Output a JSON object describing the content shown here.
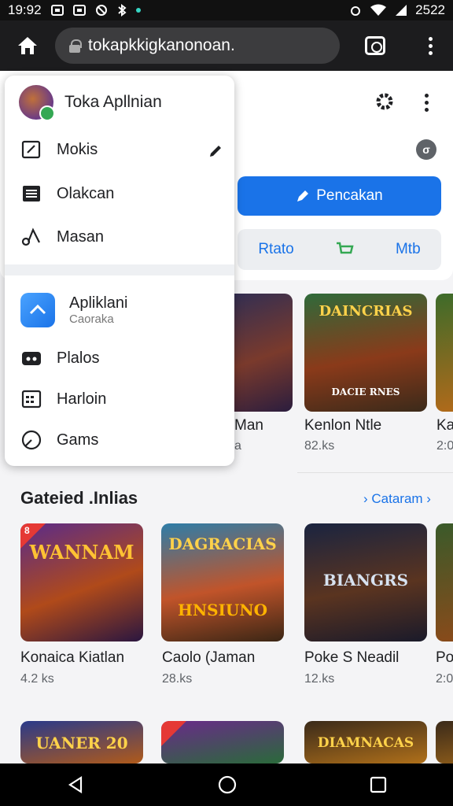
{
  "status_bar": {
    "time": "19:92",
    "battery": "2522"
  },
  "browser": {
    "url": "tokapkkigkanonoan."
  },
  "page": {
    "primary_button": "Pencakan",
    "segment": {
      "left": "Rtato",
      "right": "Mtb"
    },
    "games_row1": [
      {
        "title": "Man",
        "size": "a"
      },
      {
        "title": "Kenlon Ntle",
        "size": "82.ks",
        "art": "DAINCRIAS",
        "art_sub": "DACIE RNES"
      },
      {
        "title": "Ka",
        "size": "2:0"
      }
    ],
    "section": {
      "title": "Gateied .Inlias",
      "link": "Cataram"
    },
    "games_row2": [
      {
        "title": "Konaica Kiatlan",
        "size": "4.2 ks",
        "art": "WANNAM",
        "badge": "8"
      },
      {
        "title": "Caolo (Jaman",
        "size": "28.ks",
        "art": "DAGRACIAS",
        "art_sub": "HNSIUNO"
      },
      {
        "title": "Poke S Neadil",
        "size": "12.ks",
        "art": "BIANGRS"
      },
      {
        "title": "Po",
        "size": "2:0"
      }
    ],
    "games_row3": [
      {
        "art": "UANER 20"
      },
      {
        "art": ""
      },
      {
        "art": "DIAMNACAS"
      }
    ]
  },
  "menu": {
    "app_title": "Toka Apllnian",
    "items_top": [
      {
        "label": "Mokis",
        "icon": "edit-square-icon"
      },
      {
        "label": "Olakcan",
        "icon": "list-icon"
      },
      {
        "label": "Masan",
        "icon": "music-note-icon"
      }
    ],
    "app2": {
      "title": "Apliklani",
      "subtitle": "Caoraka"
    },
    "items_bottom": [
      {
        "label": "Plalos",
        "icon": "gamepad-icon"
      },
      {
        "label": "Harloin",
        "icon": "calendar-icon"
      },
      {
        "label": "Gams",
        "icon": "search-circle-icon"
      }
    ]
  },
  "colors": {
    "accent": "#1a73e8",
    "toolbar": "#1c1c1e",
    "badge": "#e53935"
  }
}
